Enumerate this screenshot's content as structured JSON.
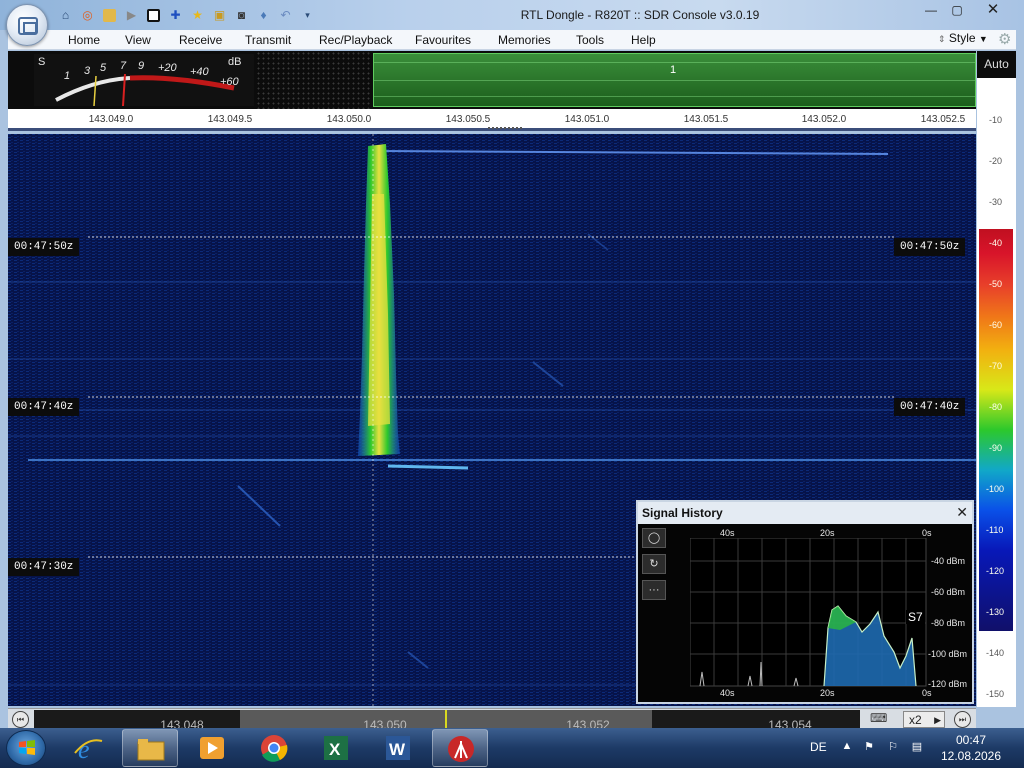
{
  "window": {
    "title": "RTL Dongle - R820T :: SDR Console v3.0.19",
    "minimize": "—",
    "maximize": "▢",
    "close": "✕"
  },
  "menu": {
    "items": [
      "Home",
      "View",
      "Receive",
      "Transmit",
      "Rec/Playback",
      "Favourites",
      "Memories",
      "Tools",
      "Help"
    ],
    "style_label": "Style"
  },
  "smeter": {
    "s_label": "S",
    "db_label": "dB",
    "scale": [
      "1",
      "3",
      "5",
      "7",
      "9",
      "+20",
      "+40",
      "+60"
    ]
  },
  "spectrum": {
    "channel_label": "1"
  },
  "frequency_scale": [
    "143.049.0",
    "143.049.5",
    "143.050.0",
    "143.050.5",
    "143.051.0",
    "143.051.5",
    "143.052.0",
    "143.052.5"
  ],
  "waterfall": {
    "timestamps": [
      "00:47:50z",
      "00:47:40z",
      "00:47:30z"
    ]
  },
  "db_scale": {
    "auto_label": "Auto",
    "labels": [
      "-10",
      "-20",
      "-30",
      "-40",
      "-50",
      "-60",
      "-70",
      "-80",
      "-90",
      "-100",
      "-110",
      "-120",
      "-130",
      "-140",
      "-150"
    ]
  },
  "tuner": {
    "labels": [
      "143.048",
      "143.050",
      "143.052",
      "143.054"
    ],
    "zoom": "x2"
  },
  "signal_history": {
    "title": "Signal History",
    "close": "✕",
    "time_labels": [
      "40s",
      "20s",
      "0s"
    ],
    "dbm_labels": [
      "-40 dBm",
      "-60 dBm",
      "-80 dBm",
      "-100 dBm",
      "-120 dBm"
    ],
    "s_reading": "S7",
    "buttons": [
      "◯",
      "↻",
      "···"
    ]
  },
  "taskbar": {
    "language": "DE",
    "time": "00:47",
    "date": "12.08.2026"
  },
  "colors": {
    "waterfall_bg": "#06134a",
    "signal_core": "#e8e040",
    "signal_mid": "#2cc82c",
    "spectrum_green": "#3a8e3a",
    "meter_red": "#c01818"
  }
}
